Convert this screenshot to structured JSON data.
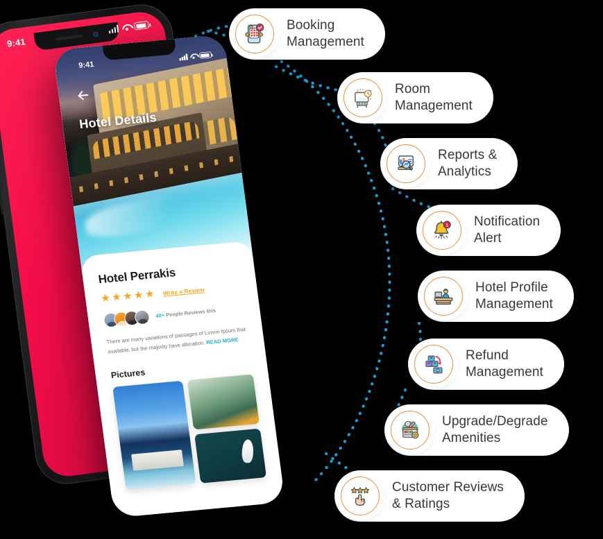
{
  "scene": {
    "background_color": "#000000",
    "accent_orange": "#ef8c3b",
    "accent_blue_dots": "#1b9ad6",
    "phone_red": "#f50d49"
  },
  "phone_back": {
    "status_time": "9:41",
    "signal_icon": "signal-bars-icon",
    "wifi_icon": "wifi-icon",
    "battery_icon": "battery-icon"
  },
  "phone_front": {
    "status_time": "9:41",
    "signal_icon": "signal-bars-icon",
    "wifi_icon": "wifi-icon",
    "battery_icon": "battery-icon",
    "back_icon": "back-arrow-icon",
    "screen_title": "Hotel Details",
    "hotel_name": "Hotel Perrakis",
    "stars": "★★★★★",
    "star_count": 5,
    "write_review": "Write a Review",
    "reviewers_count": "40+",
    "reviewers_text": "People Reviews this",
    "description": "There are many variations of passages of Lorem Ipsum that available, but the majority have alteration.",
    "read_more": "READ MORE",
    "pictures_title": "Pictures",
    "avatars": [
      {
        "name": "avatar-1"
      },
      {
        "name": "avatar-2"
      },
      {
        "name": "avatar-3"
      },
      {
        "name": "avatar-4"
      }
    ],
    "pictures": [
      {
        "name": "picture-pool-villa"
      },
      {
        "name": "picture-mountain-greenery"
      },
      {
        "name": "picture-boat-sea"
      }
    ]
  },
  "features": [
    {
      "id": "booking-management",
      "label": "Booking\nManagement",
      "icon": "booking-phone-icon"
    },
    {
      "id": "room-management",
      "label": "Room\nManagement",
      "icon": "room-board-icon"
    },
    {
      "id": "reports-analytics",
      "label": "Reports &\nAnalytics",
      "icon": "reports-chart-icon"
    },
    {
      "id": "notification-alert",
      "label": "Notification\nAlert",
      "icon": "bell-alert-icon"
    },
    {
      "id": "hotel-profile",
      "label": "Hotel Profile\nManagement",
      "icon": "reception-desk-icon"
    },
    {
      "id": "refund-management",
      "label": "Refund\nManagement",
      "icon": "refund-box-money-icon"
    },
    {
      "id": "upgrade-amenities",
      "label": "Upgrade/Degrade\nAmenities",
      "icon": "amenities-tools-icon"
    },
    {
      "id": "customer-reviews",
      "label": "Customer Reviews\n& Ratings",
      "icon": "stars-hand-icon"
    }
  ]
}
